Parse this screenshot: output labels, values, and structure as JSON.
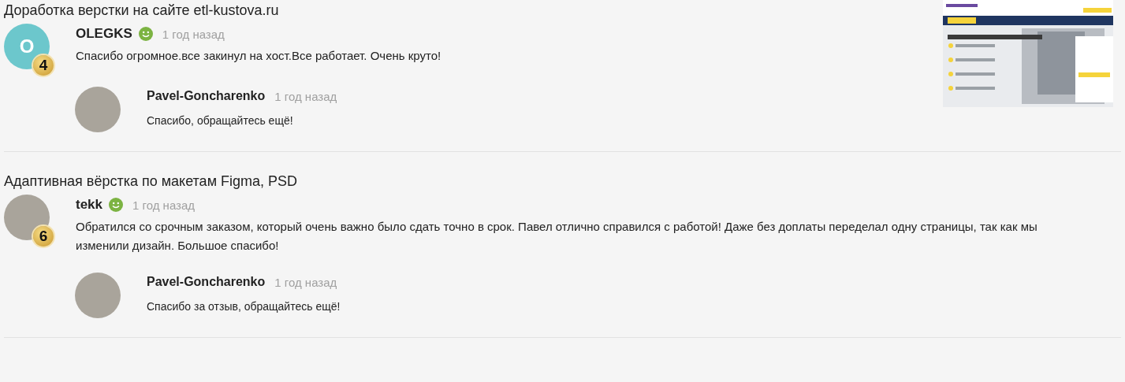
{
  "reviews": [
    {
      "title": "Доработка верстки на сайте etl-kustova.ru",
      "preview": true,
      "author": {
        "name": "OLEGKS",
        "kind": "letter",
        "initial": "O",
        "badge": "4"
      },
      "time": "1 год назад",
      "text": "Спасибо огромное.все закинул на хост.Все работает. Очень круто!",
      "reply": {
        "name": "Pavel-Goncharenko",
        "time": "1 год назад",
        "text": "Спасибо, обращайтесь ещё!"
      }
    },
    {
      "title": "Адаптивная вёрстка по макетам Figma, PSD",
      "preview": false,
      "author": {
        "name": "tekk",
        "kind": "photo",
        "badge": "6"
      },
      "time": "1 год назад",
      "text": "Обратился со срочным заказом, который очень важно было сдать точно в срок. Павел отлично справился с работой! Даже без доплаты переделал одну страницы, так как мы изменили дизайн. Большое спасибо!",
      "reply": {
        "name": "Pavel-Goncharenko",
        "time": "1 год назад",
        "text": "Спасибо за отзыв, обращайтесь ещё!"
      }
    }
  ]
}
